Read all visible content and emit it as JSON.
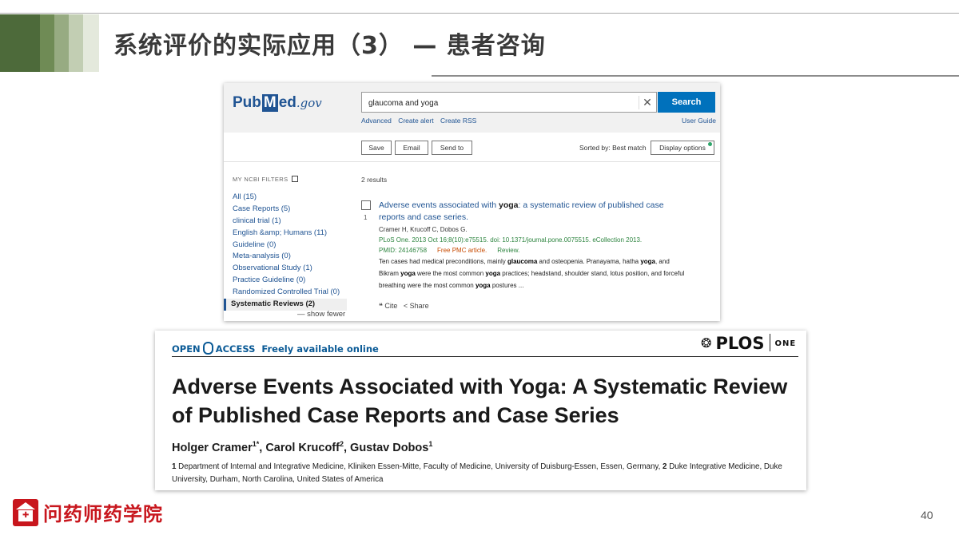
{
  "slide": {
    "title": "系统评价的实际应用（3） — 患者咨询",
    "page_number": "40",
    "footer_brand": "问药师药学院",
    "header_stripe_colors": [
      "#4d6a3a",
      "#6f8b55",
      "#97ab82",
      "#c2ceb3",
      "#e4e9dc"
    ]
  },
  "pubmed": {
    "logo": {
      "pub": "Pub",
      "m": "M",
      "ed": "ed",
      "gov": ".gov"
    },
    "search": {
      "value": "glaucoma and yoga",
      "button": "Search",
      "clear_icon": "close-icon"
    },
    "links": {
      "advanced": "Advanced",
      "create_alert": "Create alert",
      "create_rss": "Create RSS",
      "user_guide": "User Guide"
    },
    "actions": {
      "save": "Save",
      "email": "Email",
      "send_to": "Send to",
      "sorted_by": "Sorted by: Best match",
      "display_options": "Display options"
    },
    "filters_header": "MY NCBI FILTERS",
    "filters": [
      "All (15)",
      "Case Reports (5)",
      "clinical trial (1)",
      "English &amp; Humans (11)",
      "Guideline (0)",
      "Meta-analysis (0)",
      "Observational Study (1)",
      "Practice Guideline (0)",
      "Randomized Controlled Trial (0)",
      "Systematic Reviews (2)"
    ],
    "show_fewer": "show fewer",
    "results_count": "2 results",
    "result": {
      "number": "1",
      "title_pre": "Adverse events associated with ",
      "title_bold": "yoga",
      "title_post": ": a systematic review of published case reports and case series.",
      "authors": "Cramer H, Krucoff C, Dobos G.",
      "citation": "PLoS One. 2013 Oct 16;8(10):e75515. doi: 10.1371/journal.pone.0075515. eCollection 2013.",
      "pmid": "PMID: 24146758",
      "free_pmc": "Free PMC article.",
      "review": "Review.",
      "snippet": {
        "s1": "Ten cases had medical preconditions, mainly ",
        "b1": "glaucoma",
        "s2": " and osteopenia. Pranayama, hatha ",
        "b2": "yoga",
        "s3": ", and Bikram ",
        "b3": "yoga",
        "s4": " were the most common ",
        "b4": "yoga",
        "s5": " practices; headstand, shoulder stand, lotus position, and forceful breathing were the most common ",
        "b5": "yoga",
        "s6": " postures ..."
      },
      "cite": "Cite",
      "share": "Share"
    }
  },
  "plos": {
    "open_access": {
      "open": "OPEN",
      "access": "ACCESS",
      "freely": "Freely available online"
    },
    "logo": {
      "word": "PLOS",
      "one": "ONE"
    },
    "title": "Adverse Events Associated with Yoga: A Systematic Review of Published Case Reports and Case Series",
    "authors": [
      {
        "name": "Holger Cramer",
        "sup": "1*"
      },
      {
        "name": "Carol Krucoff",
        "sup": "2"
      },
      {
        "name": "Gustav Dobos",
        "sup": "1"
      }
    ],
    "affiliations": {
      "n1": "1",
      "t1": " Department of Internal and Integrative Medicine, Kliniken Essen-Mitte, Faculty of Medicine, University of Duisburg-Essen, Essen, Germany, ",
      "n2": "2",
      "t2": " Duke Integrative Medicine, Duke University, Durham, North Carolina, United States of America"
    }
  }
}
